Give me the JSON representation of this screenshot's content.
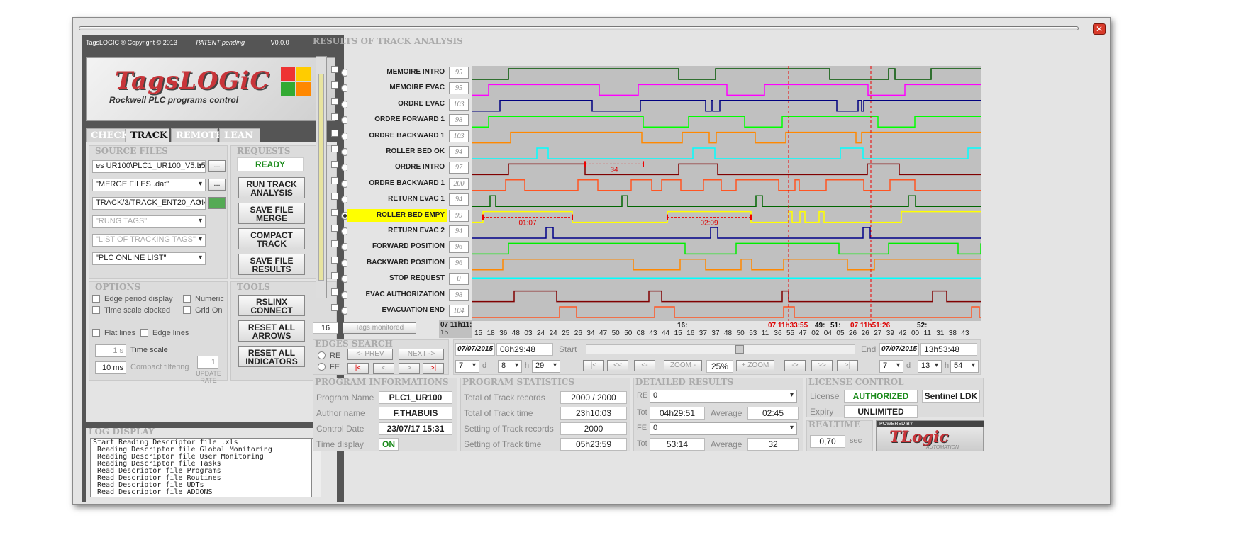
{
  "app": {
    "titlebar_text": "TagsLOGIC ®  Copyright © 2013",
    "patent": "PATENT pending",
    "version": "V0.0.0",
    "close_glyph": "✕",
    "logo_title": "TagsLOGiC",
    "logo_subtitle": "Rockwell PLC programs control"
  },
  "tabs": [
    {
      "label": "CHECK"
    },
    {
      "label": "TRACK"
    },
    {
      "label": "REMOTE"
    },
    {
      "label": "LEAN ..."
    }
  ],
  "source_files": {
    "title": "SOURCE FILES",
    "file1": "es UR100\\PLC1_UR100_V5.L5X",
    "file2": "\"MERGE FILES .dat\"",
    "file3": "TRACK/3/TRACK_ENT20_AOI4",
    "rung_tags": "\"RUNG TAGS\"",
    "tracking_tags": "\"LIST OF TRACKING TAGS\"",
    "plc_online": "\"PLC ONLINE LIST\"",
    "dots": "..."
  },
  "requests": {
    "title": "REQUESTS",
    "status": "READY",
    "run_track": "RUN TRACK ANALYSIS",
    "save_merge": "SAVE FILE MERGE",
    "compact_track": "COMPACT TRACK",
    "save_results": "SAVE FILE RESULTS"
  },
  "options": {
    "title": "OPTIONS",
    "edge_period": "Edge period display",
    "numeric": "Numeric",
    "time_scale_clocked": "Time scale clocked",
    "grid_on": "Grid On",
    "flat_lines": "Flat lines",
    "edge_lines": "Edge lines",
    "time_scale_value": "1 s",
    "time_scale_label": "Time scale",
    "compact_value": "10 ms",
    "compact_label": "Compact filtering",
    "update_value": "1",
    "update_label": "UPDATE RATE"
  },
  "tools": {
    "title": "TOOLS",
    "rslinx": "RSLINX CONNECT",
    "reset_arrows": "RESET ALL ARROWS",
    "reset_indicators": "RESET ALL INDICATORS"
  },
  "log": {
    "title": "LOG DISPLAY",
    "lines": "Start Reading Descriptor file .xls\n Reading Descriptor file Global Monitoring\n Reading Descriptor file User Monitoring\n Reading Descriptor file Tasks\n Read Descriptor file Programs\n Read Descriptor file Routines\n Read Descriptor file UDTs\n Read Descriptor file ADDONS"
  },
  "results": {
    "title": "RESULTS OF TRACK ANALYSIS",
    "count": "16",
    "tags_monitored": "Tags monitored",
    "time_start": "07 11h11:",
    "time_first": "15",
    "signals": [
      {
        "name": "MEMOIRE INTRO",
        "num": "95",
        "color": "#005500"
      },
      {
        "name": "MEMOIRE EVAC",
        "num": "95",
        "color": "#ff00ff"
      },
      {
        "name": "ORDRE EVAC",
        "num": "103",
        "color": "#000080"
      },
      {
        "name": "ORDRE FORWARD 1",
        "num": "98",
        "color": "#00ff00"
      },
      {
        "name": "ORDRE BACKWARD 1",
        "num": "103",
        "color": "#ff8800"
      },
      {
        "name": "ROLLER BED OK",
        "num": "94",
        "color": "#00ffff"
      },
      {
        "name": "ORDRE INTRO",
        "num": "97",
        "color": "#800000"
      },
      {
        "name": "ORDRE BACKWARD 1",
        "num": "200",
        "color": "#ff5522"
      },
      {
        "name": "RETURN EVAC 1",
        "num": "94",
        "color": "#006600"
      },
      {
        "name": "ROLLER BED EMPY",
        "num": "99",
        "color": "#ffff00"
      },
      {
        "name": "RETURN EVAC 2",
        "num": "94",
        "color": "#000088"
      },
      {
        "name": "FORWARD POSITION",
        "num": "96",
        "color": "#00ee00"
      },
      {
        "name": "BACKWARD POSITION",
        "num": "96",
        "color": "#ff8800"
      },
      {
        "name": "STOP REQUEST",
        "num": "0",
        "color": "#00ffff"
      },
      {
        "name": "EVAC AUTHORIZATION",
        "num": "98",
        "color": "#800000"
      },
      {
        "name": "EVACUATION END",
        "num": "104",
        "color": "#ff5522"
      }
    ],
    "annotations": [
      "34",
      "01:07",
      "02:09"
    ],
    "ticks": [
      "15",
      "18",
      "36",
      "48",
      "03",
      "24",
      "24",
      "25",
      "26",
      "34",
      "47",
      "50",
      "50",
      "08",
      "43",
      "44",
      "15",
      "16",
      "37",
      "37",
      "48",
      "50",
      "53",
      "11",
      "36",
      "55",
      "47",
      "02",
      "04",
      "05",
      "26",
      "26",
      "27",
      "39",
      "42",
      "00",
      "11",
      "31",
      "38",
      "43"
    ],
    "strip_marks": [
      "16:",
      "07 11h33:55",
      "49:",
      "51:",
      "07 11h51:26",
      "52:"
    ]
  },
  "edges": {
    "title": "EDGES SEARCH",
    "re": "RE",
    "fe": "FE",
    "prev": "<- PREV",
    "next": "NEXT ->",
    "first": "|<",
    "back": "<",
    "fwd": ">",
    "last": ">|",
    "start_date": "07/07/2015",
    "start_time": "08h29:48",
    "start_label": "Start",
    "end_label": "End",
    "end_date": "07/07/2015",
    "end_time": "13h53:48",
    "d1": "7",
    "d1_unit": "d",
    "h1": "8",
    "h1_unit": "h",
    "m1": "29",
    "d2": "7",
    "d2_unit": "d",
    "h2": "13",
    "h2_unit": "h",
    "m2": "54",
    "nav_first": "|<",
    "nav_rew": "<<",
    "nav_back": "<-",
    "zoom_out": "ZOOM -",
    "zoom": "25%",
    "zoom_in": "+ ZOOM",
    "nav_fwd": "->",
    "nav_ff": ">>",
    "nav_last": ">|"
  },
  "program_info": {
    "title": "PROGRAM INFORMATIONS",
    "name_label": "Program Name",
    "name": "PLC1_UR100",
    "author_label": "Author name",
    "author": "F.THABUIS",
    "date_label": "Control Date",
    "date": "23/07/17 15:31",
    "display_label": "Time display",
    "display": "ON"
  },
  "program_stats": {
    "title": "PROGRAM STATISTICS",
    "records_label": "Total of Track records",
    "records": "2000 / 2000",
    "time_label": "Total of Track time",
    "time": "23h10:03",
    "setting_records_label": "Setting of Track records",
    "setting_records": "2000",
    "setting_time_label": "Setting of Track time",
    "setting_time": "05h23:59"
  },
  "detailed": {
    "title": "DETAILED RESULTS",
    "re_label": "RE",
    "re_value": "0",
    "tot_label": "Tot",
    "re_tot": "04h29:51",
    "avg_label": "Average",
    "re_avg": "02:45",
    "fe_label": "FE",
    "fe_value": "0",
    "fe_tot": "53:14",
    "fe_avg": "32"
  },
  "license": {
    "title": "LICENSE CONTROL",
    "license_label": "License",
    "license": "AUTHORIZED",
    "provider": "Sentinel LDK",
    "expiry_label": "Expiry",
    "expiry": "UNLIMITED"
  },
  "realtime": {
    "title": "REALTIME",
    "value": "0,70",
    "unit": "sec",
    "powered": "POWERED BY",
    "brand": "TLogic",
    "brand_sub": "AUTOMATION"
  }
}
